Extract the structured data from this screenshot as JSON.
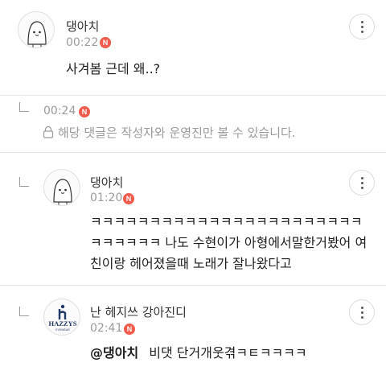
{
  "comments": [
    {
      "author": "댕아치",
      "time": "00:22",
      "badge": "N",
      "text": "사겨봄 근데 왜..?"
    },
    {
      "time": "00:24",
      "badge": "N",
      "hidden_note": "해당 댓글은 작성자와 운영진만 볼 수 있습니다."
    },
    {
      "author": "댕아치",
      "time": "01:20",
      "badge": "N",
      "lines": [
        "ㅋㅋㅋㅋㅋㅋㅋㅋㅋㅋㅋㅋㅋㅋㅋㅋㅋㅋㅋㅋㅋㅋㅋ",
        "ㅋㅋㅋㅋㅋㅋ 나도 수현이가 아형에서말한거봤어 여",
        "친이랑 헤어졌을때 노래가 잘나왔다고"
      ]
    },
    {
      "author": "난 헤지쓰 강아진디",
      "time": "02:41",
      "badge": "N",
      "mention": "@댕아치",
      "text": "비댓 단거개웃겪ㅋㅌㅋㅋㅋㅋ",
      "avatar_brand": "HAZZYS",
      "avatar_sub": "EYEWEAR"
    }
  ],
  "colors": {
    "badge": "#f25a4b",
    "meta": "#9b9b9b",
    "divider": "#e6e6e6"
  }
}
